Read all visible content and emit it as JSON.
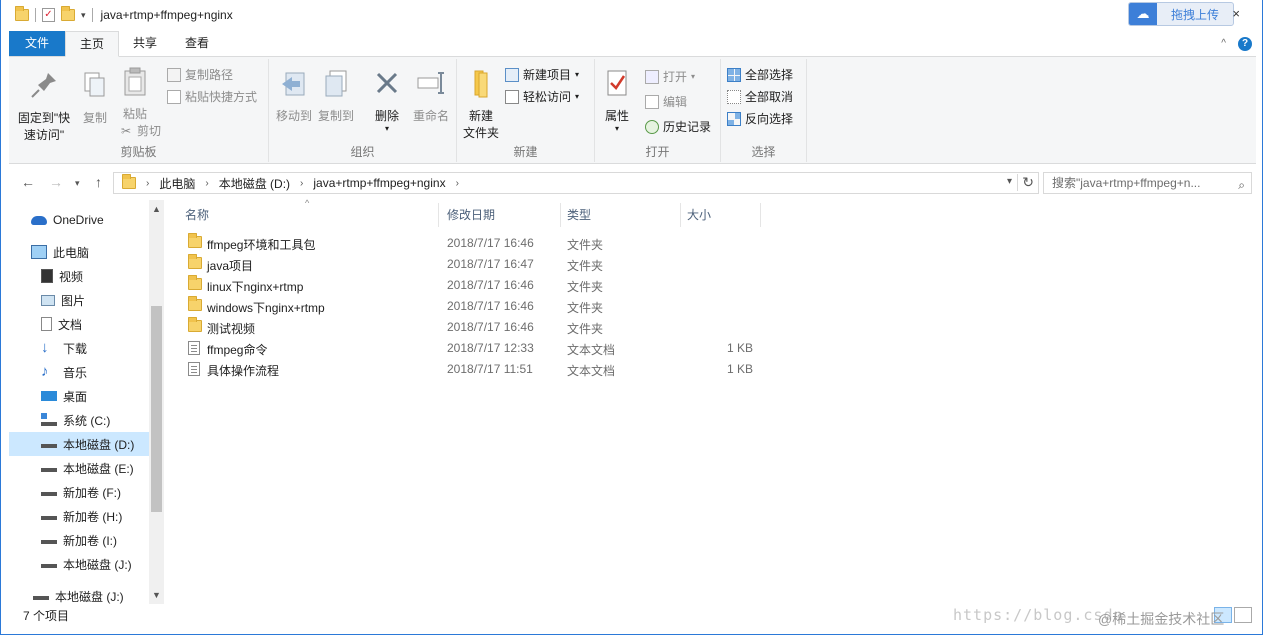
{
  "titlebar": {
    "title": "java+rtmp+ffmpeg+nginx",
    "upload_label": "拖拽上传",
    "close_glyph": "×"
  },
  "tabs": [
    {
      "label": "文件"
    },
    {
      "label": "主页"
    },
    {
      "label": "共享"
    },
    {
      "label": "查看"
    }
  ],
  "ribbon": {
    "clipboard": {
      "pin": "固定到\"快\n速访问\"",
      "copy": "复制",
      "paste": "粘贴",
      "copy_path": "复制路径",
      "paste_shortcut": "粘贴快捷方式",
      "cut": "剪切",
      "label": "剪贴板"
    },
    "organize": {
      "move_to": "移动到",
      "copy_to": "复制到",
      "delete": "删除",
      "rename": "重命名",
      "label": "组织"
    },
    "new": {
      "new_folder": "新建\n文件夹",
      "new_item": "新建项目",
      "easy_access": "轻松访问",
      "label": "新建"
    },
    "open": {
      "properties": "属性",
      "open": "打开",
      "edit": "编辑",
      "history": "历史记录",
      "label": "打开"
    },
    "select": {
      "select_all": "全部选择",
      "select_none": "全部取消",
      "invert": "反向选择",
      "label": "选择"
    }
  },
  "address": {
    "crumbs": [
      "此电脑",
      "本地磁盘 (D:)",
      "java+rtmp+ffmpeg+nginx"
    ],
    "search_placeholder": "搜索\"java+rtmp+ffmpeg+n..."
  },
  "navpane": {
    "items": [
      {
        "label": "OneDrive",
        "icon": "cloud-icon"
      },
      {
        "label": "此电脑",
        "icon": "computer-icon"
      },
      {
        "label": "视频",
        "icon": "video-icon"
      },
      {
        "label": "图片",
        "icon": "picture-icon"
      },
      {
        "label": "文档",
        "icon": "document-icon"
      },
      {
        "label": "下载",
        "icon": "download-icon"
      },
      {
        "label": "音乐",
        "icon": "music-icon"
      },
      {
        "label": "桌面",
        "icon": "desktop-icon"
      },
      {
        "label": "系统 (C:)",
        "icon": "drive-icon"
      },
      {
        "label": "本地磁盘 (D:)",
        "icon": "drive-icon"
      },
      {
        "label": "本地磁盘 (E:)",
        "icon": "drive-icon"
      },
      {
        "label": "新加卷 (F:)",
        "icon": "drive-icon"
      },
      {
        "label": "新加卷 (H:)",
        "icon": "drive-icon"
      },
      {
        "label": "新加卷 (I:)",
        "icon": "drive-icon"
      },
      {
        "label": "本地磁盘 (J:)",
        "icon": "drive-icon"
      },
      {
        "label": "本地磁盘 (J:)",
        "icon": "drive-icon"
      }
    ]
  },
  "filelist": {
    "columns": [
      "名称",
      "修改日期",
      "类型",
      "大小"
    ],
    "rows": [
      {
        "name": "ffmpeg环境和工具包",
        "date": "2018/7/17 16:46",
        "type": "文件夹",
        "size": "",
        "kind": "folder"
      },
      {
        "name": "java项目",
        "date": "2018/7/17 16:47",
        "type": "文件夹",
        "size": "",
        "kind": "folder"
      },
      {
        "name": "linux下nginx+rtmp",
        "date": "2018/7/17 16:46",
        "type": "文件夹",
        "size": "",
        "kind": "folder"
      },
      {
        "name": "windows下nginx+rtmp",
        "date": "2018/7/17 16:46",
        "type": "文件夹",
        "size": "",
        "kind": "folder"
      },
      {
        "name": "测试视频",
        "date": "2018/7/17 16:46",
        "type": "文件夹",
        "size": "",
        "kind": "folder"
      },
      {
        "name": "ffmpeg命令",
        "date": "2018/7/17 12:33",
        "type": "文本文档",
        "size": "1 KB",
        "kind": "text"
      },
      {
        "name": "具体操作流程",
        "date": "2018/7/17 11:51",
        "type": "文本文档",
        "size": "1 KB",
        "kind": "text"
      }
    ]
  },
  "status": {
    "count": "7 个项目"
  },
  "watermark": {
    "url": "https://blog.csdn",
    "credit": "@稀土掘金技术社区"
  },
  "colors": {
    "accent": "#1979ca",
    "selection": "#cce8ff",
    "folder": "#f7d36b"
  }
}
